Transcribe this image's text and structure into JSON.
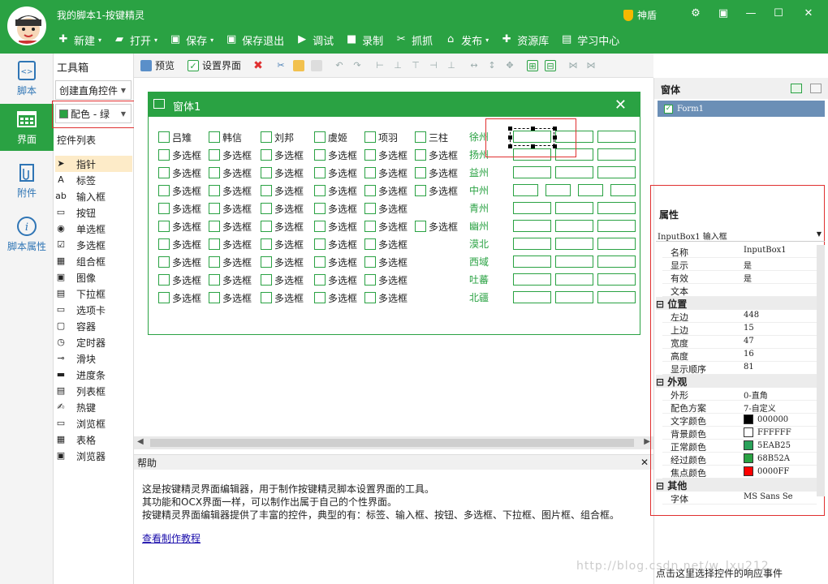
{
  "app": {
    "title": "我的脚本1-按键精灵",
    "vip_label": "神盾",
    "accent": "#2aa243"
  },
  "toolbar": {
    "new": "新建",
    "open": "打开",
    "save": "保存",
    "save_exit": "保存退出",
    "debug": "调试",
    "record": "录制",
    "capture": "抓抓",
    "publish": "发布",
    "resource": "资源库",
    "learn": "学习中心"
  },
  "leftnav": {
    "script": "脚本",
    "ui": "界面",
    "attach": "附件",
    "props": "脚本属性"
  },
  "toolbox": {
    "title": "工具箱",
    "create_select": "创建直角控件",
    "color_select": "配色 - 绿",
    "list_title": "控件列表",
    "items": [
      "指针",
      "标签",
      "输入框",
      "按钮",
      "单选框",
      "多选框",
      "组合框",
      "图像",
      "下拉框",
      "选项卡",
      "容器",
      "定时器",
      "滑块",
      "进度条",
      "列表框",
      "热键",
      "浏览框",
      "表格",
      "浏览器"
    ]
  },
  "edtoolbar": {
    "preview": "预览",
    "settings": "设置界面"
  },
  "form": {
    "title": "窗体1",
    "first_row": [
      "吕雉",
      "韩信",
      "刘邦",
      "虞姬",
      "项羽",
      "三柱"
    ],
    "checkbox_label": "多选框",
    "cities": [
      "徐州",
      "扬州",
      "益州",
      "中州",
      "青州",
      "幽州",
      "漠北",
      "西域",
      "吐蕃",
      "北疆"
    ]
  },
  "help": {
    "title": "帮助",
    "lines": [
      "这是按键精灵界面编辑器，用于制作按键精灵脚本设置界面的工具。",
      "其功能和OCX界面一样，可以制作出属于自己的个性界面。",
      "按键精灵界面编辑器提供了丰富的控件，典型的有：标签、输入框、按钮、多选框、下拉框、图片框、组合框。"
    ],
    "link": "查看制作教程"
  },
  "windows_panel": {
    "title": "窗体",
    "form_item": "Form1"
  },
  "properties": {
    "title": "属性",
    "object": "InputBox1 输入框",
    "footer": "点击这里选择控件的响应事件",
    "groups": {
      "position": "位置",
      "appearance": "外观",
      "other": "其他"
    },
    "rows": [
      {
        "k": "名称",
        "v": "InputBox1"
      },
      {
        "k": "显示",
        "v": "是"
      },
      {
        "k": "有效",
        "v": "是"
      },
      {
        "k": "文本",
        "v": ""
      }
    ],
    "pos_rows": [
      {
        "k": "左边",
        "v": "448"
      },
      {
        "k": "上边",
        "v": "15"
      },
      {
        "k": "宽度",
        "v": "47"
      },
      {
        "k": "高度",
        "v": "16"
      },
      {
        "k": "显示顺序",
        "v": "81"
      }
    ],
    "look_rows": [
      {
        "k": "外形",
        "v": "0-直角"
      },
      {
        "k": "配色方案",
        "v": "7-自定义"
      },
      {
        "k": "文字颜色",
        "v": "000000",
        "c": "#000000"
      },
      {
        "k": "背景颜色",
        "v": "FFFFFF",
        "c": "#FFFFFF"
      },
      {
        "k": "正常颜色",
        "v": "5EAB25",
        "c": "#2aa25a"
      },
      {
        "k": "经过颜色",
        "v": "68B52A",
        "c": "#2aa243"
      },
      {
        "k": "焦点颜色",
        "v": "0000FF",
        "c": "#ff0000"
      }
    ],
    "other_rows": [
      {
        "k": "字体",
        "v": "MS Sans Se"
      }
    ]
  },
  "watermark": "http://blog.csdn.net/w_lxu212"
}
